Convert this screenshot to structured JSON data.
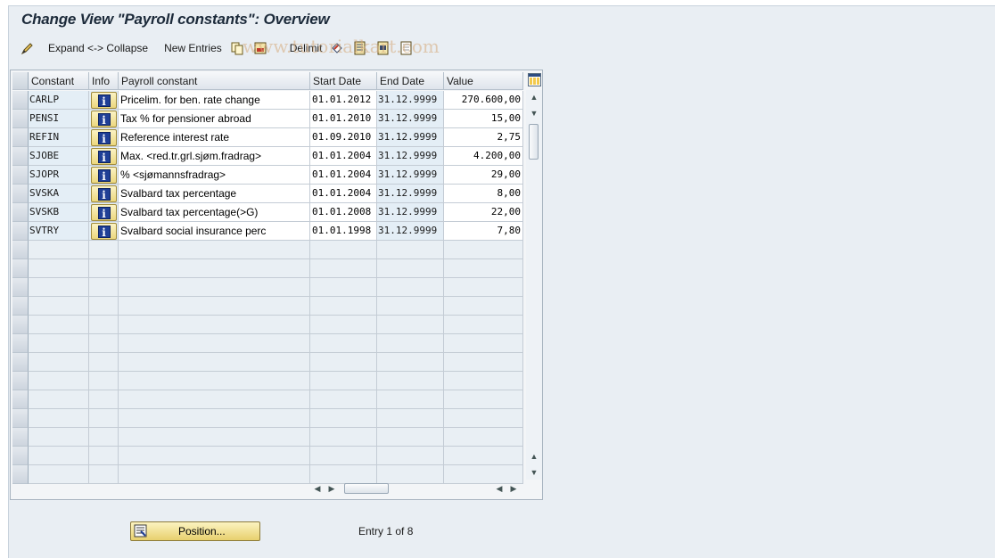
{
  "title": "Change View \"Payroll constants\": Overview",
  "toolbar": {
    "expand_collapse": "Expand <-> Collapse",
    "new_entries": "New Entries",
    "delimit": "Delimit"
  },
  "watermark": "www.tutorialkart.com",
  "columns": {
    "constant": "Constant",
    "info": "Info",
    "payroll_constant": "Payroll constant",
    "start_date": "Start Date",
    "end_date": "End Date",
    "value": "Value"
  },
  "rows": [
    {
      "constant": "CARLP",
      "text": "Pricelim. for ben. rate change",
      "start": "01.01.2012",
      "end": "31.12.9999",
      "value": "270.600,00"
    },
    {
      "constant": "PENSI",
      "text": "Tax % for pensioner abroad",
      "start": "01.01.2010",
      "end": "31.12.9999",
      "value": "15,00"
    },
    {
      "constant": "REFIN",
      "text": "Reference interest rate",
      "start": "01.09.2010",
      "end": "31.12.9999",
      "value": "2,75"
    },
    {
      "constant": "SJOBE",
      "text": "Max. <red.tr.grl.sjøm.fradrag>",
      "start": "01.01.2004",
      "end": "31.12.9999",
      "value": "4.200,00"
    },
    {
      "constant": "SJOPR",
      "text": "% <sjømannsfradrag>",
      "start": "01.01.2004",
      "end": "31.12.9999",
      "value": "29,00"
    },
    {
      "constant": "SVSKA",
      "text": "Svalbard tax percentage",
      "start": "01.01.2004",
      "end": "31.12.9999",
      "value": "8,00"
    },
    {
      "constant": "SVSKB",
      "text": "Svalbard tax percentage(>G)",
      "start": "01.01.2008",
      "end": "31.12.9999",
      "value": "22,00"
    },
    {
      "constant": "SVTRY",
      "text": "Svalbard social insurance perc",
      "start": "01.01.1998",
      "end": "31.12.9999",
      "value": "7,80"
    }
  ],
  "position_button": "Position...",
  "entry_info": "Entry 1 of 8"
}
